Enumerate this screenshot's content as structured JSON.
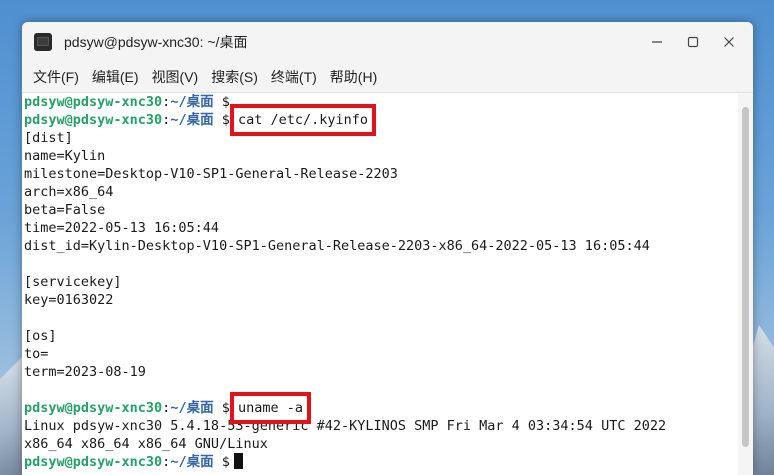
{
  "window": {
    "title": "pdsyw@pdsyw-xnc30: ~/桌面"
  },
  "menu": [
    {
      "label": "文件(F)"
    },
    {
      "label": "编辑(E)"
    },
    {
      "label": "视图(V)"
    },
    {
      "label": "搜索(S)"
    },
    {
      "label": "终端(T)"
    },
    {
      "label": "帮助(H)"
    }
  ],
  "prompt": {
    "user": "pdsyw@pdsyw-xnc30",
    "sep": ":",
    "path": "~/桌面",
    "symbol": "$"
  },
  "commands": {
    "cat": "cat /etc/.kyinfo",
    "uname": "uname -a"
  },
  "output": {
    "dist": [
      "[dist]",
      "name=Kylin",
      "milestone=Desktop-V10-SP1-General-Release-2203",
      "arch=x86_64",
      "beta=False",
      "time=2022-05-13 16:05:44",
      "dist_id=Kylin-Desktop-V10-SP1-General-Release-2203-x86_64-2022-05-13 16:05:44",
      "",
      "[servicekey]",
      "key=0163022",
      "",
      "[os]",
      "to=",
      "term=2023-08-19",
      ""
    ],
    "uname": [
      "Linux pdsyw-xnc30 5.4.18-53-generic #42-KYLINOS SMP Fri Mar 4 03:34:54 UTC 2022",
      "x86_64 x86_64 x86_64 GNU/Linux"
    ]
  },
  "colors": {
    "prompt_user": "#26a269",
    "prompt_path": "#3465a4",
    "highlight_box": "#e1121b"
  },
  "icons": {
    "app": "terminal-icon",
    "minimize": "minimize-icon",
    "maximize": "maximize-icon",
    "close": "close-icon"
  }
}
